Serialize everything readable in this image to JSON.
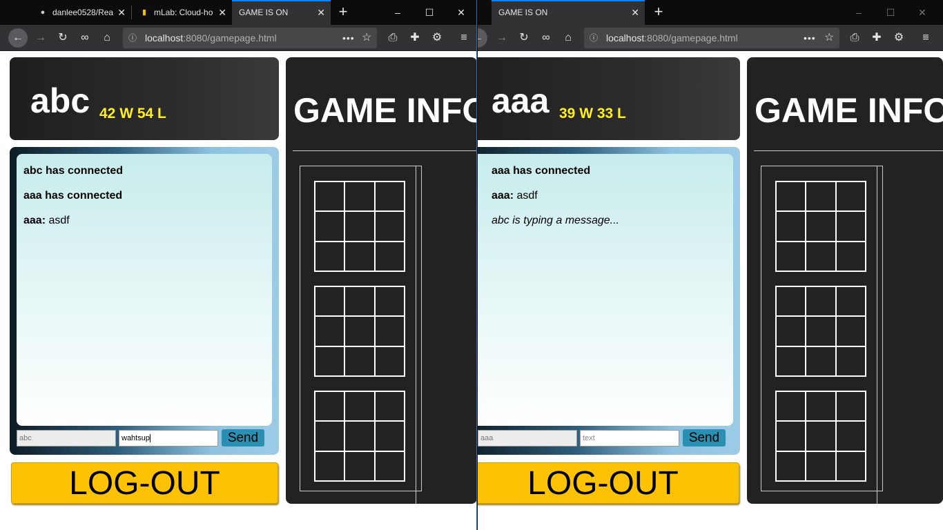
{
  "left": {
    "tabs": [
      {
        "title": "danlee0528/Rea",
        "icon": "github-icon"
      },
      {
        "title": "mLab: Cloud-ho",
        "icon": "mlab-icon"
      },
      {
        "title": "GAME IS ON",
        "active": true
      }
    ],
    "url_host": "localhost",
    "url_rest": ":8080/gamepage.html",
    "player": {
      "name": "abc",
      "record": "42 W 54 L"
    },
    "game_title": "GAME INFO",
    "chat": {
      "messages": [
        {
          "type": "system",
          "text": "abc has connected"
        },
        {
          "type": "system",
          "text": "aaa has connected"
        },
        {
          "type": "message",
          "user": "aaa:",
          "text": " asdf"
        }
      ],
      "name_value": "abc",
      "message_value": "wahtsup"
    },
    "send_label": "Send",
    "logout_label": "LOG-OUT"
  },
  "right": {
    "tabs": [
      {
        "title": "GAME IS ON",
        "active": true
      }
    ],
    "url_host": "localhost",
    "url_rest": ":8080/gamepage.html",
    "player": {
      "name": "aaa",
      "record": "39 W 33 L"
    },
    "game_title": "GAME INFO",
    "chat": {
      "messages": [
        {
          "type": "system",
          "text": "aaa has connected"
        },
        {
          "type": "message",
          "user": "aaa:",
          "text": " asdf"
        },
        {
          "type": "typing",
          "text": "abc is typing a message..."
        }
      ],
      "name_value": "aaa",
      "message_placeholder": "text"
    },
    "send_label": "Send",
    "logout_label": "LOG-OUT"
  },
  "icons": {
    "close": "✕",
    "new_tab": "+",
    "minimize": "–",
    "maximize": "☐",
    "back": "←",
    "forward": "→",
    "reload": "↻",
    "more": "•••",
    "star": "☆",
    "menu": "≡"
  },
  "colors": {
    "record": "#ffef1f",
    "logout": "#fdc203",
    "send": "#2a8fb1",
    "game_bg": "#222222",
    "accent_tab": "#0a84ff"
  }
}
